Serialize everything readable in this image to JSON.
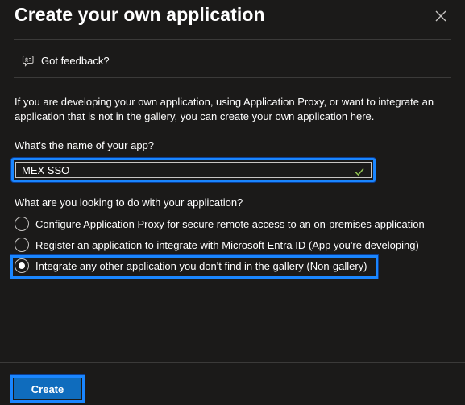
{
  "dialog": {
    "title": "Create your own application",
    "close_label": "Close"
  },
  "feedback": {
    "label": "Got feedback?"
  },
  "description": "If you are developing your own application, using Application Proxy, or want to integrate an application that is not in the gallery, you can create your own application here.",
  "app_name": {
    "label": "What's the name of your app?",
    "value": "MEX SSO",
    "valid": true
  },
  "purpose": {
    "label": "What are you looking to do with your application?",
    "options": [
      {
        "label": "Configure Application Proxy for secure remote access to an on-premises application",
        "selected": false
      },
      {
        "label": "Register an application to integrate with Microsoft Entra ID (App you're developing)",
        "selected": false
      },
      {
        "label": "Integrate any other application you don't find in the gallery (Non-gallery)",
        "selected": true
      }
    ]
  },
  "footer": {
    "create_label": "Create"
  },
  "colors": {
    "background": "#1b1a19",
    "accent_highlight": "#1a86ff",
    "primary_button": "#0f6cbd",
    "divider": "#3b3a39",
    "valid_check": "#92c353"
  },
  "icons": {
    "close": "close-icon",
    "feedback": "feedback-icon",
    "valid": "checkmark-icon"
  }
}
